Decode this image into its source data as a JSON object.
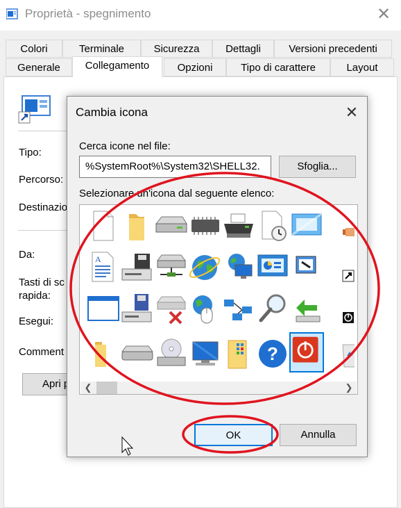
{
  "window": {
    "title": "Proprietà - spegnimento",
    "close_glyph": "✕",
    "tabs_row1": [
      "Colori",
      "Terminale",
      "Sicurezza",
      "Dettagli",
      "Versioni precedenti"
    ],
    "tabs_row2": [
      "Generale",
      "Collegamento",
      "Opzioni",
      "Tipo di carattere",
      "Layout"
    ],
    "active_tab": "Collegamento",
    "fields": {
      "tipo": "Tipo:",
      "percorso": "Percorso:",
      "destinazione": "Destinazio",
      "da": "Da:",
      "tasti_line1": "Tasti di sc",
      "tasti_line2": "rapida:",
      "esegui": "Esegui:",
      "commento": "Comment"
    },
    "open_button": "Apri p"
  },
  "dialog": {
    "title": "Cambia icona",
    "close_glyph": "✕",
    "search_label": "Cerca icone nel file:",
    "file_value": "%SystemRoot%\\System32\\SHELL32.",
    "browse_button": "Sfoglia...",
    "list_label": "Selezionare un'icona dal seguente elenco:",
    "icons_row1": [
      "blank-document-icon",
      "folder-icon",
      "hard-drive-icon",
      "memory-chip-icon",
      "printer-icon",
      "document-clock-icon",
      "window-tiles-icon",
      "pointing-hand-icon"
    ],
    "icons_row2": [
      "text-document-icon",
      "computer-floppy-icon",
      "network-drive-icon",
      "globe-icon",
      "network-globe-monitor-icon",
      "control-panel-icon",
      "app-window-icon",
      "shortcut-arrow-icon"
    ],
    "icons_row3": [
      "blank-window-icon",
      "floppy-computer-icon",
      "disconnected-drive-icon",
      "globe-mouse-icon",
      "network-icon",
      "magnifier-icon",
      "green-arrow-drive-icon",
      "power-small-icon"
    ],
    "icons_row4": [
      "folder-partial-icon",
      "drive-icon",
      "cd-drive-icon",
      "monitor-icon",
      "folder-grid-icon",
      "help-icon",
      "power-off-icon",
      "recycle-bin-icon"
    ],
    "selected_icon": "power-off-icon",
    "help_glyph": "?",
    "scroll_left": "❮",
    "scroll_right": "❯",
    "ok_button": "OK",
    "cancel_button": "Annulla"
  },
  "colors": {
    "annotation_red": "#e0141e",
    "accent_blue": "#0078d7",
    "power_red": "#d9381e"
  }
}
